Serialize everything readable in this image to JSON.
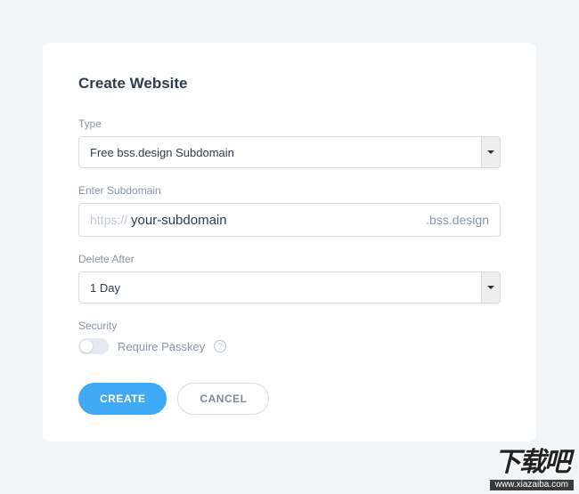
{
  "title": "Create Website",
  "type": {
    "label": "Type",
    "selected": "Free bss.design Subdomain"
  },
  "subdomain": {
    "label": "Enter Subdomain",
    "prefix": "https://",
    "placeholder": "your-subdomain",
    "suffix": ".bss.design"
  },
  "deleteAfter": {
    "label": "Delete After",
    "selected": "1 Day"
  },
  "security": {
    "label": "Security",
    "toggleLabel": "Require Passkey"
  },
  "buttons": {
    "create": "CREATE",
    "cancel": "CANCEL"
  },
  "watermark": {
    "text": "下载吧",
    "url": "www.xiazaiba.com"
  }
}
